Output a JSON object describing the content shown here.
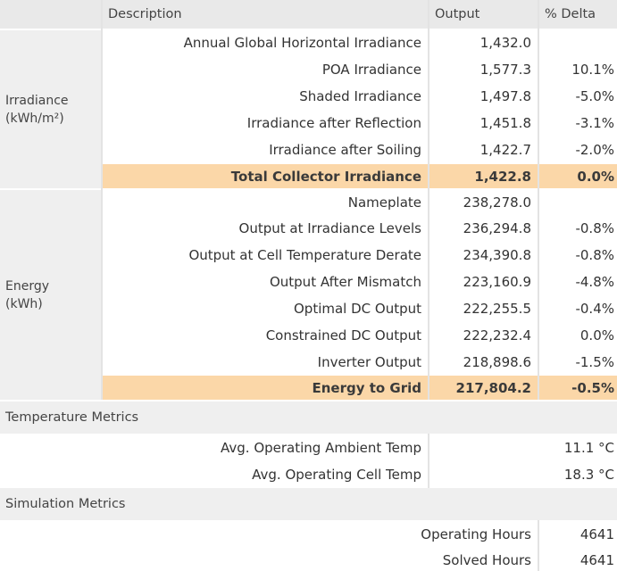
{
  "header": {
    "description": "Description",
    "output": "Output",
    "delta": "% Delta"
  },
  "groups": {
    "irradiance": {
      "line1": "Irradiance",
      "line2": "(kWh/m²)"
    },
    "energy": {
      "line1": "Energy",
      "line2": "(kWh)"
    }
  },
  "irradiance_rows": [
    {
      "label": "Annual Global Horizontal Irradiance",
      "output": "1,432.0",
      "delta": ""
    },
    {
      "label": "POA Irradiance",
      "output": "1,577.3",
      "delta": "10.1%"
    },
    {
      "label": "Shaded Irradiance",
      "output": "1,497.8",
      "delta": "-5.0%"
    },
    {
      "label": "Irradiance after Reflection",
      "output": "1,451.8",
      "delta": "-3.1%"
    },
    {
      "label": "Irradiance after Soiling",
      "output": "1,422.7",
      "delta": "-2.0%"
    },
    {
      "label": "Total Collector Irradiance",
      "output": "1,422.8",
      "delta": "0.0%"
    }
  ],
  "energy_rows": [
    {
      "label": "Nameplate",
      "output": "238,278.0",
      "delta": ""
    },
    {
      "label": "Output at Irradiance Levels",
      "output": "236,294.8",
      "delta": "-0.8%"
    },
    {
      "label": "Output at Cell Temperature Derate",
      "output": "234,390.8",
      "delta": "-0.8%"
    },
    {
      "label": "Output After Mismatch",
      "output": "223,160.9",
      "delta": "-4.8%"
    },
    {
      "label": "Optimal DC Output",
      "output": "222,255.5",
      "delta": "-0.4%"
    },
    {
      "label": "Constrained DC Output",
      "output": "222,232.4",
      "delta": "0.0%"
    },
    {
      "label": "Inverter Output",
      "output": "218,898.6",
      "delta": "-1.5%"
    },
    {
      "label": "Energy to Grid",
      "output": "217,804.2",
      "delta": "-0.5%"
    }
  ],
  "temperature": {
    "title": "Temperature Metrics",
    "rows": [
      {
        "label": "Avg. Operating Ambient Temp",
        "value": "11.1 °C"
      },
      {
        "label": "Avg. Operating Cell Temp",
        "value": "18.3 °C"
      }
    ]
  },
  "simulation": {
    "title": "Simulation Metrics",
    "rows": [
      {
        "label": "Operating Hours",
        "value": "4641"
      },
      {
        "label": "Solved Hours",
        "value": "4641"
      }
    ]
  },
  "colors": {
    "highlight": "#fbd7a8",
    "header_bg": "#e9e9e9",
    "group_bg": "#efefef"
  }
}
